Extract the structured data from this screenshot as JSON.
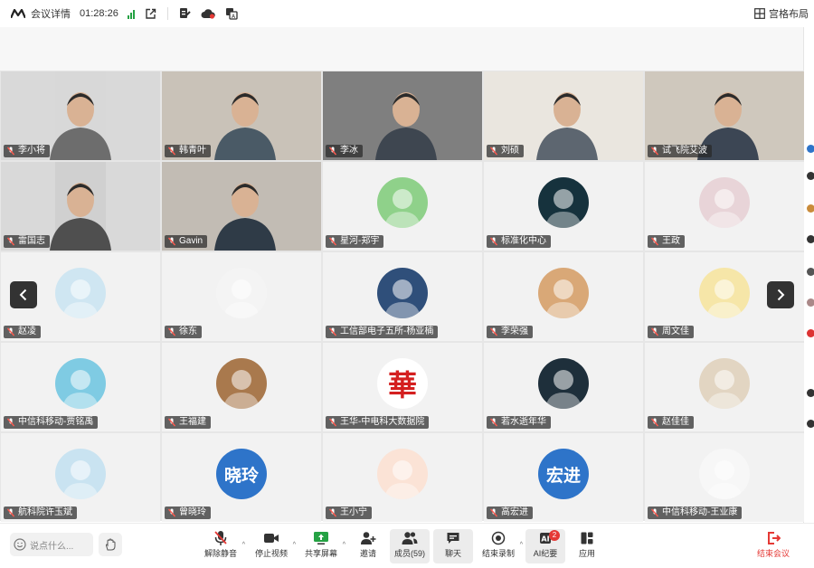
{
  "topbar": {
    "meeting_details": "会议详情",
    "elapsed": "01:28:26",
    "layout_label": "宫格布局"
  },
  "participants": [
    {
      "name": "李小将",
      "kind": "video"
    },
    {
      "name": "韩青叶",
      "kind": "video"
    },
    {
      "name": "李冰",
      "kind": "video"
    },
    {
      "name": "刘硕",
      "kind": "video"
    },
    {
      "name": "试飞院艾波",
      "kind": "video"
    },
    {
      "name": "雷国志",
      "kind": "video"
    },
    {
      "name": "Gavin",
      "kind": "video"
    },
    {
      "name": "星河-郑宇",
      "kind": "avatar",
      "avatar_color": "#8fd18a"
    },
    {
      "name": "标准化中心",
      "kind": "avatar",
      "avatar_color": "#16323d"
    },
    {
      "name": "王政",
      "kind": "avatar",
      "avatar_color": "#e8d4d8"
    },
    {
      "name": "赵凌",
      "kind": "avatar",
      "avatar_color": "#cfe6f2"
    },
    {
      "name": "徐东",
      "kind": "avatar",
      "avatar_color": "#f4f4f4"
    },
    {
      "name": "工信部电子五所-杨亚楠",
      "kind": "avatar",
      "avatar_color": "#2f4f7a"
    },
    {
      "name": "李荣强",
      "kind": "avatar",
      "avatar_color": "#d9a877"
    },
    {
      "name": "周文佳",
      "kind": "avatar",
      "avatar_color": "#f6e6a8"
    },
    {
      "name": "中信科移动-贾铭禹",
      "kind": "avatar",
      "avatar_color": "#7fcbe3"
    },
    {
      "name": "王福建",
      "kind": "avatar",
      "avatar_color": "#a9794d"
    },
    {
      "name": "王华-中电科大数据院",
      "kind": "avatar",
      "avatar_color": "#ffffff",
      "avatar_text": "華",
      "avatar_text_color": "#d41f1f"
    },
    {
      "name": "若水逝年华",
      "kind": "avatar",
      "avatar_color": "#1e2f3b"
    },
    {
      "name": "赵佳佳",
      "kind": "avatar",
      "avatar_color": "#e2d5c2"
    },
    {
      "name": "航科院许玉斌",
      "kind": "avatar",
      "avatar_color": "#c9e3f1"
    },
    {
      "name": "曾晓玲",
      "kind": "avatar",
      "avatar_color": "#2e74c9",
      "avatar_text": "晓玲",
      "avatar_text_color": "#ffffff"
    },
    {
      "name": "王小宁",
      "kind": "avatar",
      "avatar_color": "#fbe3d6"
    },
    {
      "name": "高宏进",
      "kind": "avatar",
      "avatar_color": "#2e74c9",
      "avatar_text": "宏进",
      "avatar_text_color": "#ffffff"
    },
    {
      "name": "中信科移动-王业康",
      "kind": "avatar",
      "avatar_color": "#f7f7f7"
    }
  ],
  "bottombar": {
    "chat_placeholder": "说点什么...",
    "unmute": "解除静音",
    "stop_video": "停止视频",
    "share_screen": "共享屏幕",
    "invite": "邀请",
    "members": "成员(59)",
    "chat": "聊天",
    "end_recording": "结束录制",
    "ai_summary": "AI纪要",
    "ai_badge": "2",
    "apps": "应用",
    "end_meeting": "结束会议"
  },
  "colors": {
    "accent_blue": "#2e74c9",
    "danger_red": "#e53935",
    "signal_green": "#25a244"
  }
}
